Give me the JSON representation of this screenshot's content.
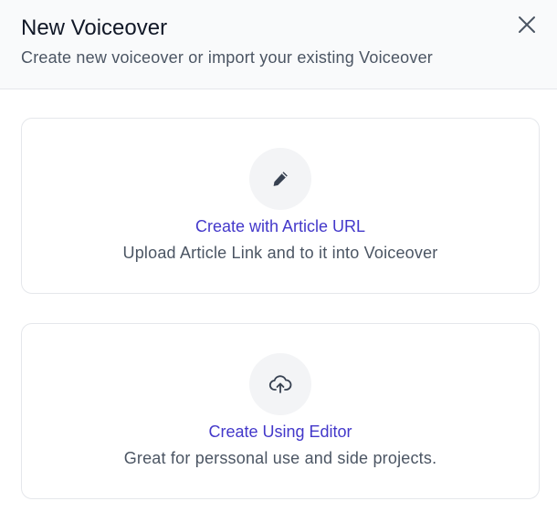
{
  "modal": {
    "title": "New Voiceover",
    "subtitle": "Create new voiceover or import your existing Voiceover",
    "close_icon": "close-icon"
  },
  "options": [
    {
      "icon": "pencil-icon",
      "title": "Create with Article URL",
      "description": "Upload Article Link and to it into Voiceover"
    },
    {
      "icon": "cloud-upload-icon",
      "title": "Create Using Editor",
      "description": "Great for perssonal use and side projects."
    }
  ],
  "colors": {
    "accent": "#4338ca",
    "header_bg": "#f9fafb",
    "border": "#e5e7eb",
    "icon_bg": "#f3f4f6",
    "icon": "#374151"
  }
}
